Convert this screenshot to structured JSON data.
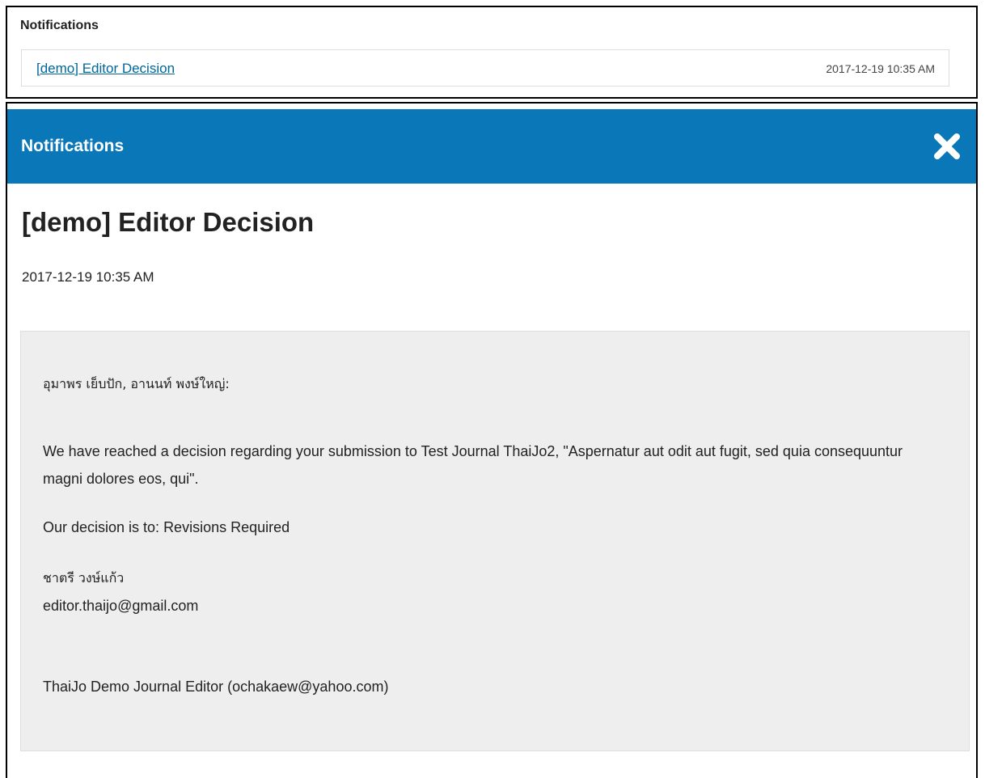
{
  "notifications_panel": {
    "title": "Notifications",
    "items": [
      {
        "label": "[demo] Editor Decision",
        "timestamp": "2017-12-19 10:35 AM"
      }
    ]
  },
  "modal": {
    "header_title": "Notifications",
    "close_icon": "close-icon",
    "heading": "[demo] Editor Decision",
    "date": "2017-12-19 10:35 AM",
    "message": {
      "salutation": "อุมาพร เย็บปัก, อานนท์ พงษ์ใหญ่:",
      "body": "We have reached a decision regarding your submission to Test Journal ThaiJo2, \"Aspernatur aut odit aut fugit, sed quia consequuntur magni dolores eos, qui\".",
      "decision": "Our decision is to: Revisions Required",
      "editor_name": "ชาตรี วงษ์แก้ว",
      "editor_email": "editor.thaijo@gmail.com",
      "signature": "ThaiJo Demo Journal Editor (ochakaew@yahoo.com)"
    }
  },
  "colors": {
    "header_bg": "#0a78b8",
    "link": "#006798",
    "message_bg": "#eeeeee"
  }
}
